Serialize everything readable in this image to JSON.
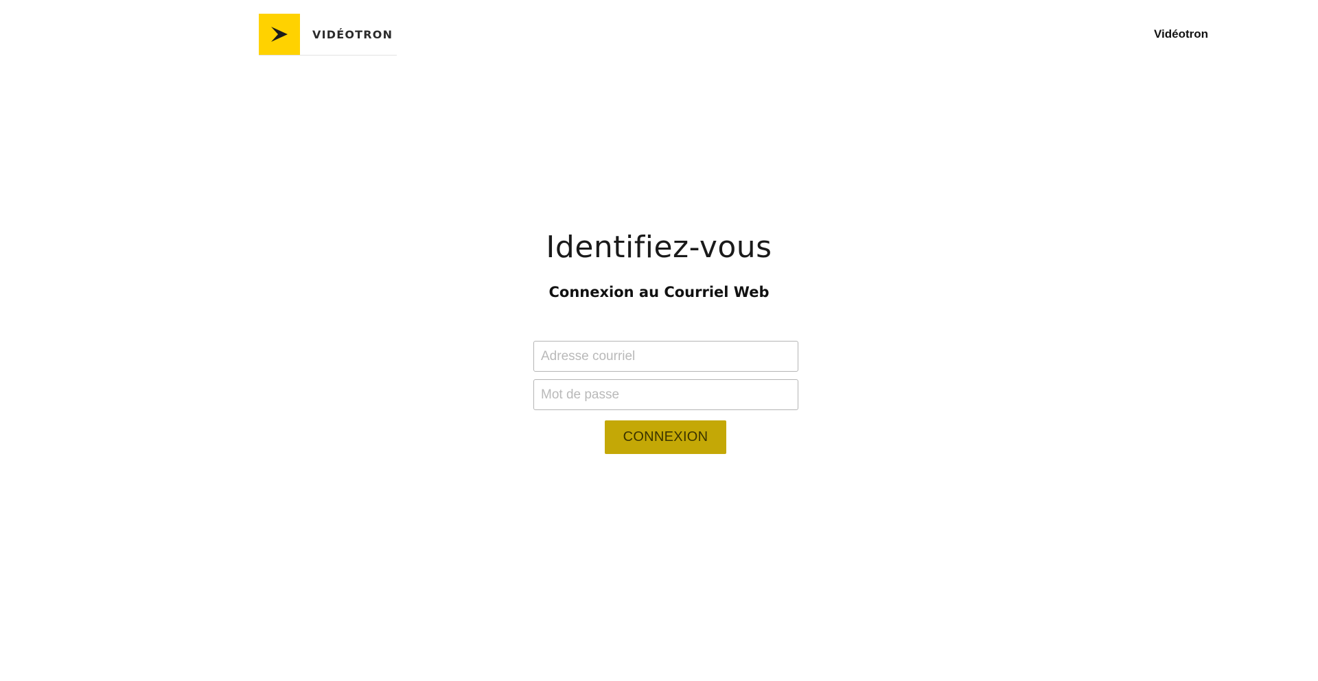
{
  "header": {
    "logo": {
      "icon": "arrow-chevron-icon",
      "text": "VIDÉOTRON",
      "background_color": "#ffd200"
    },
    "top_link": "Vidéotron"
  },
  "login": {
    "title": "Identifiez-vous",
    "subtitle": "Connexion au Courriel Web",
    "email_placeholder": "Adresse courriel",
    "email_value": "",
    "password_placeholder": "Mot de passe",
    "password_value": "",
    "submit_label": "CONNEXION",
    "submit_color": "#c4a806"
  }
}
